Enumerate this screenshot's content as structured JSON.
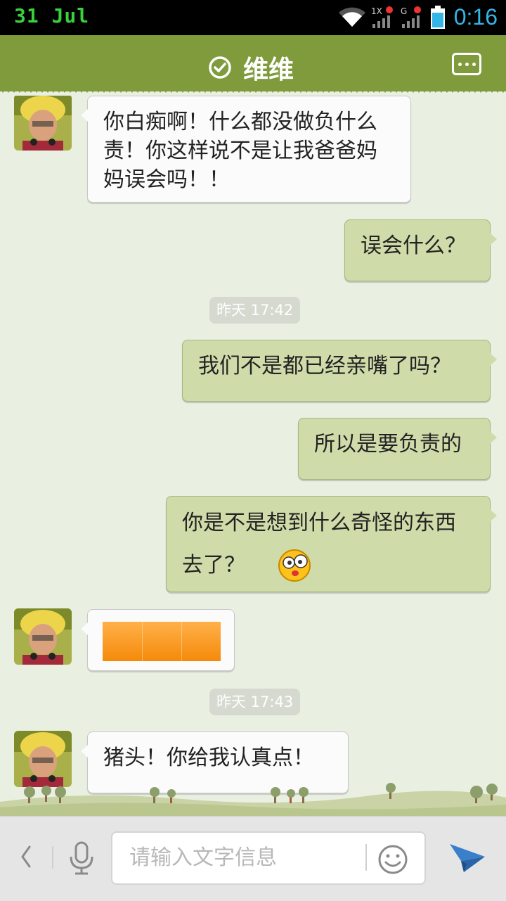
{
  "status_bar": {
    "date": "31 Jul",
    "time": "0:16",
    "network_1": "1X",
    "network_2": "G"
  },
  "header": {
    "title": "维维"
  },
  "messages": [
    {
      "side": "in",
      "text": "你白痴啊！什么都没做负什么责！你这样说不是让我爸爸妈妈误会吗！！"
    },
    {
      "side": "out",
      "text": "误会什么？"
    },
    {
      "timestamp": "昨天 17:42"
    },
    {
      "side": "out",
      "text": "我们不是都已经亲嘴了吗？"
    },
    {
      "side": "out",
      "text": "所以是要负责的"
    },
    {
      "side": "out",
      "text": "你是不是想到什么奇怪的东西去了？",
      "emoji": "dizzy-emoji-icon"
    },
    {
      "side": "in",
      "type": "sticker"
    },
    {
      "timestamp": "昨天 17:43"
    },
    {
      "side": "in",
      "text": "猪头！你给我认真点！"
    }
  ],
  "input_bar": {
    "placeholder": "请输入文字信息"
  },
  "colors": {
    "header": "#7f9b3c",
    "outgoing_bubble": "#cfdcaa",
    "incoming_bubble": "#fbfbfb",
    "background": "#e9efe1",
    "time_accent": "#33b5e5"
  },
  "icons": [
    "wifi-icon",
    "signal-icon",
    "battery-icon",
    "check-circle-icon",
    "more-menu-icon",
    "back-arrow-icon",
    "microphone-icon",
    "smiley-icon",
    "send-icon"
  ]
}
